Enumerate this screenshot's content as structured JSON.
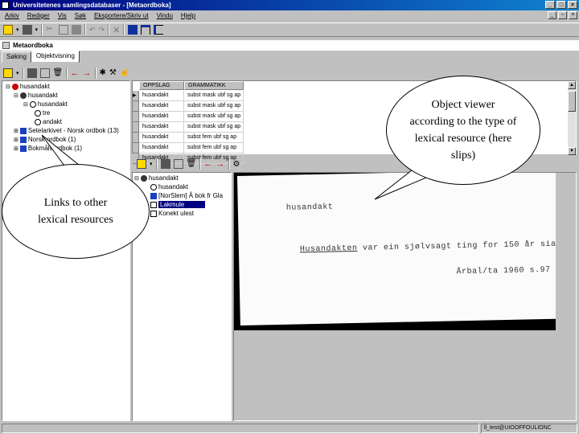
{
  "window": {
    "title": "Universitetenes samlingsdatabaser - [Metaordboka]"
  },
  "menu": [
    "Arkiv",
    "Rediger",
    "Vis",
    "Søk",
    "Eksportere/Skriv ut",
    "Vindu",
    "Hjelp"
  ],
  "document": {
    "title": "Metaordboka"
  },
  "tabs": [
    {
      "label": "Søking",
      "active": false
    },
    {
      "label": "Objektvisning",
      "active": true
    }
  ],
  "left_tree": [
    {
      "label": "husandakt"
    },
    {
      "label": "husandakt"
    },
    {
      "label": "husandakt"
    },
    {
      "label": "tre"
    },
    {
      "label": "andakt"
    },
    {
      "label": "Setelarkivet - Norsk ordbok (13)"
    },
    {
      "label": "Norsk ordbok (1)"
    },
    {
      "label": "Bokmålsordbok (1)"
    }
  ],
  "grid": {
    "columns": [
      "OPPSLAG",
      "GRAMMATIKK"
    ],
    "rows": [
      [
        "husandakt",
        "subst mask ubf sg ap"
      ],
      [
        "husandakt",
        "subst mask ubf sg ap"
      ],
      [
        "husandakt",
        "subst mask ubf sg ap"
      ],
      [
        "husandakt",
        "subst mask ubf sg ap"
      ],
      [
        "husandakt",
        "subst fem ubf sg ap"
      ],
      [
        "husandakt",
        "subst fem ubf sg ap"
      ],
      [
        "husandakt",
        "subst fem ubf sg ap"
      ]
    ]
  },
  "middle_tree": [
    {
      "label": "husandakt"
    },
    {
      "label": "husandakt"
    },
    {
      "label": "[NorSlem] Å bok fr Gla"
    },
    {
      "label": "Lakmule"
    },
    {
      "label": "Konekt ulest"
    }
  ],
  "slip": {
    "headword": "husandakt",
    "sentence_keyword": "Husandakten",
    "sentence_rest": " var ein sjølvsagt ting for 150 år sia.",
    "source": "Årbal/ta 1960  s.97"
  },
  "status": {
    "user": "ll_test@UIOOFFOULIONC"
  },
  "callouts": {
    "links": "Links to other lexical resources",
    "viewer": "Object viewer according to the type of lexical resource (here slips)"
  }
}
